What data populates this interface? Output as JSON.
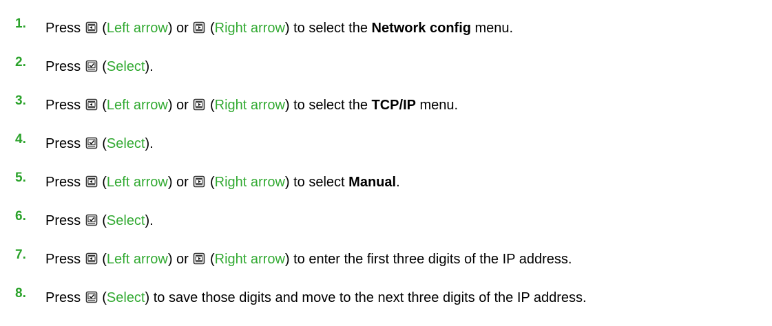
{
  "steps": [
    {
      "num": "1.",
      "parts": [
        {
          "t": "text",
          "v": "Press "
        },
        {
          "t": "icon",
          "icon": "left-arrow-key-icon"
        },
        {
          "t": "text",
          "v": " ("
        },
        {
          "t": "link",
          "v": "Left arrow"
        },
        {
          "t": "text",
          "v": ") or "
        },
        {
          "t": "icon",
          "icon": "right-arrow-key-icon"
        },
        {
          "t": "text",
          "v": " ("
        },
        {
          "t": "link",
          "v": "Right arrow"
        },
        {
          "t": "text",
          "v": ") to select the "
        },
        {
          "t": "bold",
          "v": "Network config"
        },
        {
          "t": "text",
          "v": " menu."
        }
      ]
    },
    {
      "num": "2.",
      "parts": [
        {
          "t": "text",
          "v": "Press "
        },
        {
          "t": "icon",
          "icon": "select-key-icon"
        },
        {
          "t": "text",
          "v": " ("
        },
        {
          "t": "link",
          "v": "Select"
        },
        {
          "t": "text",
          "v": ")."
        }
      ]
    },
    {
      "num": "3.",
      "parts": [
        {
          "t": "text",
          "v": "Press "
        },
        {
          "t": "icon",
          "icon": "left-arrow-key-icon"
        },
        {
          "t": "text",
          "v": " ("
        },
        {
          "t": "link",
          "v": "Left arrow"
        },
        {
          "t": "text",
          "v": ") or "
        },
        {
          "t": "icon",
          "icon": "right-arrow-key-icon"
        },
        {
          "t": "text",
          "v": " ("
        },
        {
          "t": "link",
          "v": "Right arrow"
        },
        {
          "t": "text",
          "v": ") to select the "
        },
        {
          "t": "bold",
          "v": "TCP/IP"
        },
        {
          "t": "text",
          "v": " menu."
        }
      ]
    },
    {
      "num": "4.",
      "parts": [
        {
          "t": "text",
          "v": "Press "
        },
        {
          "t": "icon",
          "icon": "select-key-icon"
        },
        {
          "t": "text",
          "v": " ("
        },
        {
          "t": "link",
          "v": "Select"
        },
        {
          "t": "text",
          "v": ")."
        }
      ]
    },
    {
      "num": "5.",
      "parts": [
        {
          "t": "text",
          "v": "Press "
        },
        {
          "t": "icon",
          "icon": "left-arrow-key-icon"
        },
        {
          "t": "text",
          "v": " ("
        },
        {
          "t": "link",
          "v": "Left arrow"
        },
        {
          "t": "text",
          "v": ") or "
        },
        {
          "t": "icon",
          "icon": "right-arrow-key-icon"
        },
        {
          "t": "text",
          "v": " ("
        },
        {
          "t": "link",
          "v": "Right arrow"
        },
        {
          "t": "text",
          "v": ") to select "
        },
        {
          "t": "bold",
          "v": "Manual"
        },
        {
          "t": "text",
          "v": "."
        }
      ]
    },
    {
      "num": "6.",
      "parts": [
        {
          "t": "text",
          "v": "Press "
        },
        {
          "t": "icon",
          "icon": "select-key-icon"
        },
        {
          "t": "text",
          "v": " ("
        },
        {
          "t": "link",
          "v": "Select"
        },
        {
          "t": "text",
          "v": ")."
        }
      ]
    },
    {
      "num": "7.",
      "parts": [
        {
          "t": "text",
          "v": "Press "
        },
        {
          "t": "icon",
          "icon": "left-arrow-key-icon"
        },
        {
          "t": "text",
          "v": " ("
        },
        {
          "t": "link",
          "v": "Left arrow"
        },
        {
          "t": "text",
          "v": ") or "
        },
        {
          "t": "icon",
          "icon": "right-arrow-key-icon"
        },
        {
          "t": "text",
          "v": " ("
        },
        {
          "t": "link",
          "v": "Right arrow"
        },
        {
          "t": "text",
          "v": ") to enter the first three digits of the IP address."
        }
      ]
    },
    {
      "num": "8.",
      "parts": [
        {
          "t": "text",
          "v": "Press "
        },
        {
          "t": "icon",
          "icon": "select-key-icon"
        },
        {
          "t": "text",
          "v": " ("
        },
        {
          "t": "link",
          "v": "Select"
        },
        {
          "t": "text",
          "v": ") to save those digits and move to the next three digits of the IP address."
        }
      ]
    }
  ],
  "colors": {
    "step_number": "#2aa22a",
    "link": "#33aa33",
    "text": "#000000"
  }
}
